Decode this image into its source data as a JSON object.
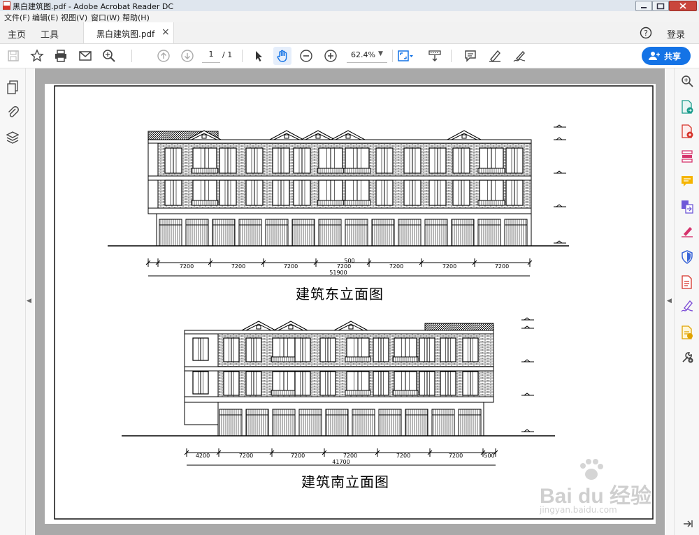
{
  "window": {
    "title": "黑白建筑图.pdf - Adobe Acrobat Reader DC"
  },
  "menu": [
    "文件(F)",
    "编辑(E)",
    "视图(V)",
    "窗口(W)",
    "帮助(H)"
  ],
  "tabs": {
    "home": "主页",
    "tools": "工具",
    "document": "黑白建筑图.pdf",
    "login": "登录"
  },
  "toolbar": {
    "page_current": "1",
    "page_total": "/ 1",
    "zoom": "62.4%",
    "share": "共享"
  },
  "drawing": {
    "east": {
      "caption": "建筑东立面图",
      "dims": [
        "500",
        "7200",
        "7200",
        "7200",
        "7200",
        "7200",
        "7200",
        "7200"
      ],
      "total": "51900"
    },
    "south": {
      "caption": "建筑南立面图",
      "dims": [
        "4200",
        "7200",
        "7200",
        "7200",
        "7200",
        "7200",
        "500"
      ],
      "total": "41700"
    }
  },
  "watermark": {
    "brand": "Bai du 经验",
    "url": "jingyan.baidu.com"
  },
  "colors": {
    "accent": "#1473e6",
    "viewer_bg": "#a9a9a9"
  }
}
